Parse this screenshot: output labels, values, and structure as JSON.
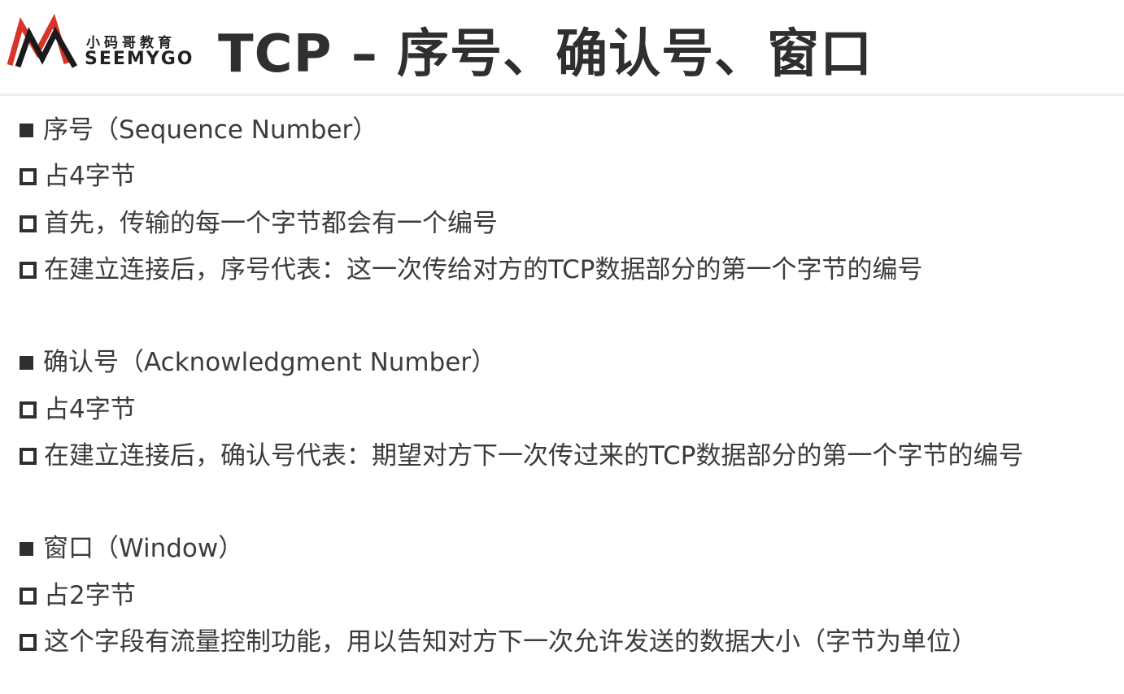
{
  "logo": {
    "cn_text": "小码哥教育",
    "en_text": "SEEMYGO",
    "colors": {
      "red": "#d9342b",
      "black": "#1a1a1a"
    }
  },
  "title": "TCP – 序号、确认号、窗口",
  "sections": [
    {
      "heading": "序号（Sequence Number）",
      "items": [
        "占4字节",
        "首先，传输的每一个字节都会有一个编号",
        "在建立连接后，序号代表：这一次传给对方的TCP数据部分的第一个字节的编号"
      ]
    },
    {
      "heading": "确认号（Acknowledgment Number）",
      "items": [
        "占4字节",
        "在建立连接后，确认号代表：期望对方下一次传过来的TCP数据部分的第一个字节的编号"
      ]
    },
    {
      "heading": "窗口（Window）",
      "items": [
        "占2字节",
        "这个字段有流量控制功能，用以告知对方下一次允许发送的数据大小（字节为单位）"
      ]
    }
  ]
}
